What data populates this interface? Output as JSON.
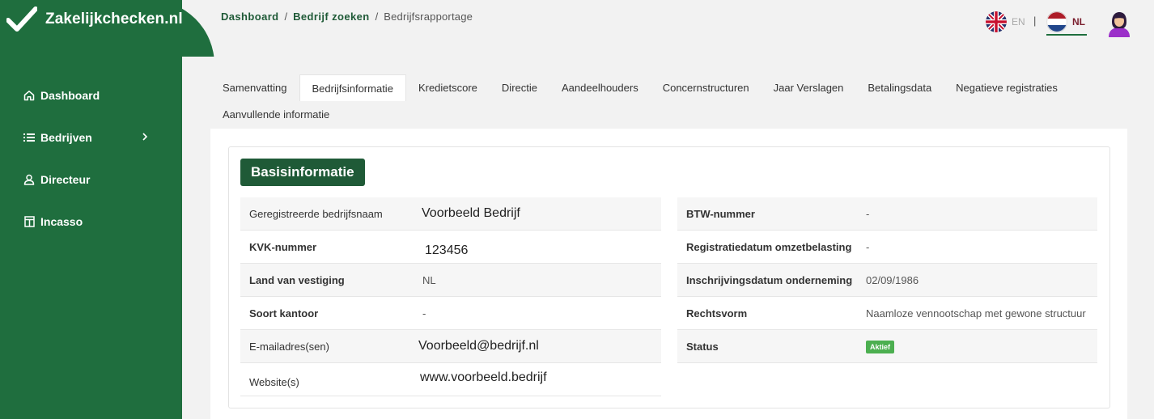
{
  "app": {
    "logo_text": "Zakelijkchecken.nl"
  },
  "sidebar": {
    "items": [
      {
        "label": "Dashboard",
        "icon": "home-icon"
      },
      {
        "label": "Bedrijven",
        "icon": "list-icon"
      },
      {
        "label": "Directeur",
        "icon": "user-icon"
      },
      {
        "label": "Incasso",
        "icon": "document-icon"
      }
    ]
  },
  "breadcrumb": {
    "items": [
      "Dashboard",
      "Bedrijf zoeken"
    ],
    "current": "Bedrijfsrapportage",
    "separator": "/"
  },
  "language": {
    "en_label": "EN",
    "nl_label": "NL",
    "separator": "|",
    "active": "NL"
  },
  "tabs": {
    "row1": [
      "Samenvatting",
      "Bedrijfsinformatie",
      "Kredietscore",
      "Directie",
      "Aandeelhouders",
      "Concernstructuren",
      "Jaar Verslagen",
      "Betalingsdata",
      "Negatieve registraties"
    ],
    "row2": [
      "Aanvullende informatie"
    ],
    "active": "Bedrijfsinformatie"
  },
  "section": {
    "title": "Basisinformatie"
  },
  "left_table": [
    {
      "label": "Geregistreerde bedrijfsnaam",
      "value": "Voorbeeld Bedrijf"
    },
    {
      "label": "KVK-nummer",
      "value": "123456"
    },
    {
      "label": "Land van vestiging",
      "value": "NL"
    },
    {
      "label": "Soort kantoor",
      "value": "-"
    },
    {
      "label": "E-mailadres(sen)",
      "value": "Voorbeeld@bedrijf.nl"
    },
    {
      "label": "Website(s)",
      "value": "www.voorbeeld.bedrijf"
    }
  ],
  "right_table": [
    {
      "label": "BTW-nummer",
      "value": "-"
    },
    {
      "label": "Registratiedatum omzetbelasting",
      "value": "-"
    },
    {
      "label": "Inschrijvingsdatum onderneming",
      "value": "02/09/1986"
    },
    {
      "label": "Rechtsvorm",
      "value": "Naamloze vennootschap met gewone structuur"
    },
    {
      "label": "Status",
      "value": "Aktief"
    }
  ],
  "colors": {
    "brand_green": "#1f6e3e",
    "dark_green": "#1f5a37",
    "status_green": "#4caf50"
  }
}
